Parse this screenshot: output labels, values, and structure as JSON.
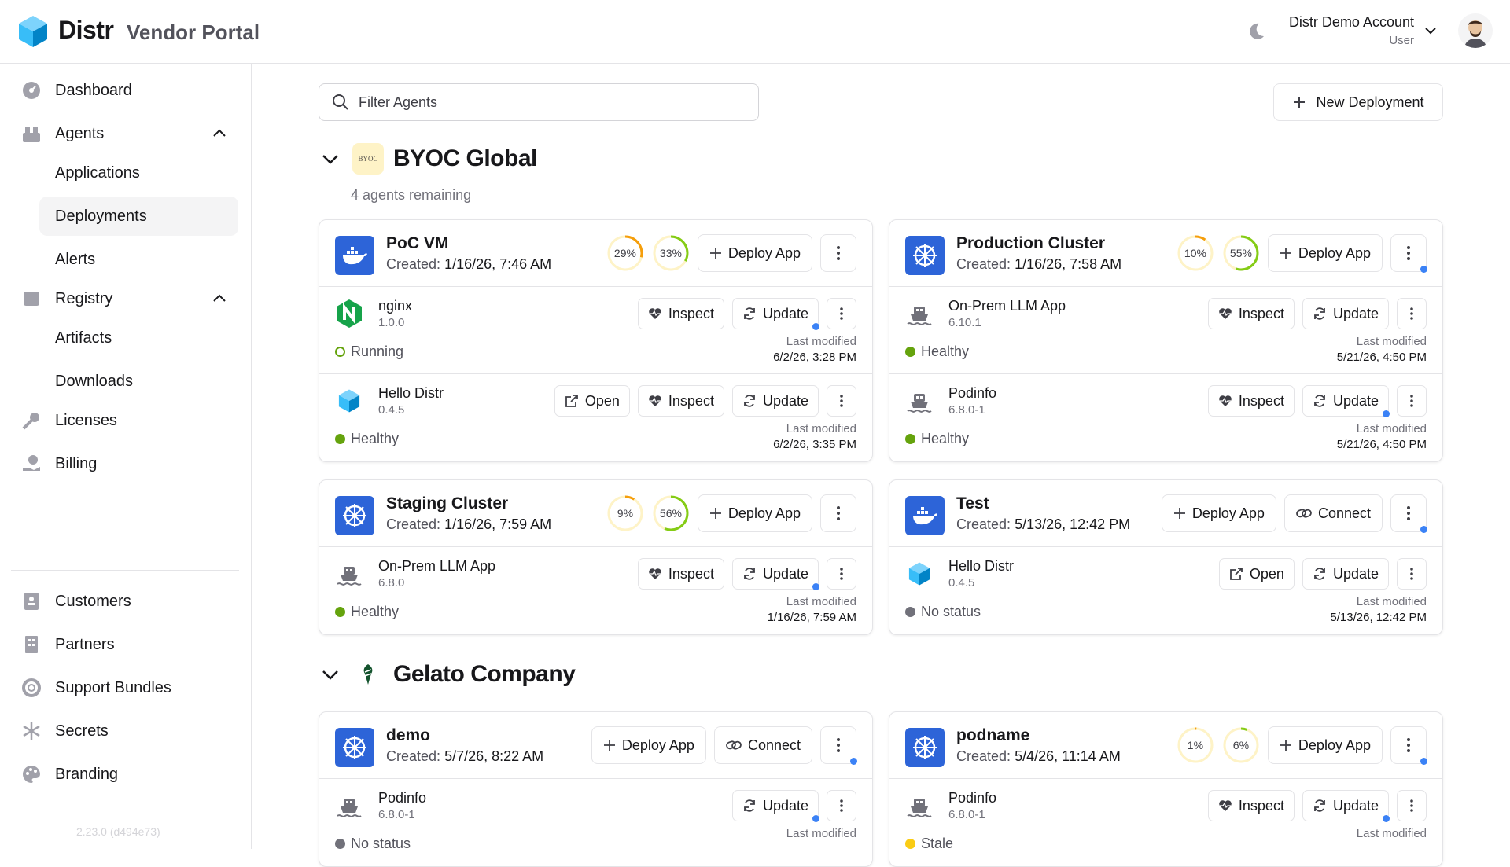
{
  "header": {
    "brand": "Distr",
    "subtitle": "Vendor Portal",
    "account_name": "Distr Demo Account",
    "account_role": "User"
  },
  "sidebar": {
    "items": [
      {
        "label": "Dashboard"
      },
      {
        "label": "Agents"
      },
      {
        "label": "Applications"
      },
      {
        "label": "Deployments"
      },
      {
        "label": "Alerts"
      },
      {
        "label": "Registry"
      },
      {
        "label": "Artifacts"
      },
      {
        "label": "Downloads"
      },
      {
        "label": "Licenses"
      },
      {
        "label": "Billing"
      },
      {
        "label": "Customers"
      },
      {
        "label": "Partners"
      },
      {
        "label": "Support Bundles"
      },
      {
        "label": "Secrets"
      },
      {
        "label": "Branding"
      }
    ],
    "version": "2.23.0 (d494e73)"
  },
  "toolbar": {
    "filter_placeholder": "Filter Agents",
    "new_deployment": "New Deployment"
  },
  "labels": {
    "deploy_app": "Deploy App",
    "inspect": "Inspect",
    "update": "Update",
    "open": "Open",
    "connect": "Connect",
    "last_modified": "Last modified",
    "created": "Created:"
  },
  "groups": [
    {
      "name": "BYOC Global",
      "remaining": "4 agents remaining",
      "logo_text": "BYOC"
    },
    {
      "name": "Gelato Company"
    }
  ],
  "cards": [
    {
      "title": "PoC VM",
      "created": "1/16/26, 7:46 AM",
      "icon": "docker-icon",
      "cpu": "29%",
      "mem": "33%",
      "cpu_val": 29,
      "mem_val": 33,
      "apps": [
        {
          "name": "nginx",
          "version": "1.0.0",
          "status": "Running",
          "modified": "6/2/26, 3:28 PM"
        },
        {
          "name": "Hello Distr",
          "version": "0.4.5",
          "status": "Healthy",
          "modified": "6/2/26, 3:35 PM"
        }
      ]
    },
    {
      "title": "Production Cluster",
      "created": "1/16/26, 7:58 AM",
      "icon": "kubernetes-icon",
      "cpu": "10%",
      "mem": "55%",
      "cpu_val": 10,
      "mem_val": 55,
      "apps": [
        {
          "name": "On-Prem LLM App",
          "version": "6.10.1",
          "status": "Healthy",
          "modified": "5/21/26, 4:50 PM"
        },
        {
          "name": "Podinfo",
          "version": "6.8.0-1",
          "status": "Healthy",
          "modified": "5/21/26, 4:50 PM"
        }
      ]
    },
    {
      "title": "Staging Cluster",
      "created": "1/16/26, 7:59 AM",
      "icon": "kubernetes-icon",
      "cpu": "9%",
      "mem": "56%",
      "cpu_val": 9,
      "mem_val": 56,
      "apps": [
        {
          "name": "On-Prem LLM App",
          "version": "6.8.0",
          "status": "Healthy",
          "modified": "1/16/26, 7:59 AM"
        }
      ]
    },
    {
      "title": "Test",
      "created": "5/13/26, 12:42 PM",
      "icon": "docker-icon",
      "apps": [
        {
          "name": "Hello Distr",
          "version": "0.4.5",
          "status": "No status",
          "modified": "5/13/26, 12:42 PM"
        }
      ]
    },
    {
      "title": "demo",
      "created": "5/7/26, 8:22 AM",
      "icon": "kubernetes-icon",
      "apps": [
        {
          "name": "Podinfo",
          "version": "6.8.0-1",
          "status": "No status"
        }
      ]
    },
    {
      "title": "podname",
      "created": "5/4/26, 11:14 AM",
      "icon": "kubernetes-icon",
      "cpu": "1%",
      "mem": "6%",
      "cpu_val": 1,
      "mem_val": 6,
      "apps": [
        {
          "name": "Podinfo",
          "version": "6.8.0-1",
          "status": "Stale"
        }
      ]
    }
  ],
  "colors": {
    "primary": "#2d64d8",
    "healthy": "#65a30d",
    "running": "#65a30d",
    "no_status": "#71717a",
    "stale": "#facc15",
    "cpu_ring": "#f59e0b",
    "mem_ring": "#84cc16",
    "dot": "#3b82f6"
  }
}
